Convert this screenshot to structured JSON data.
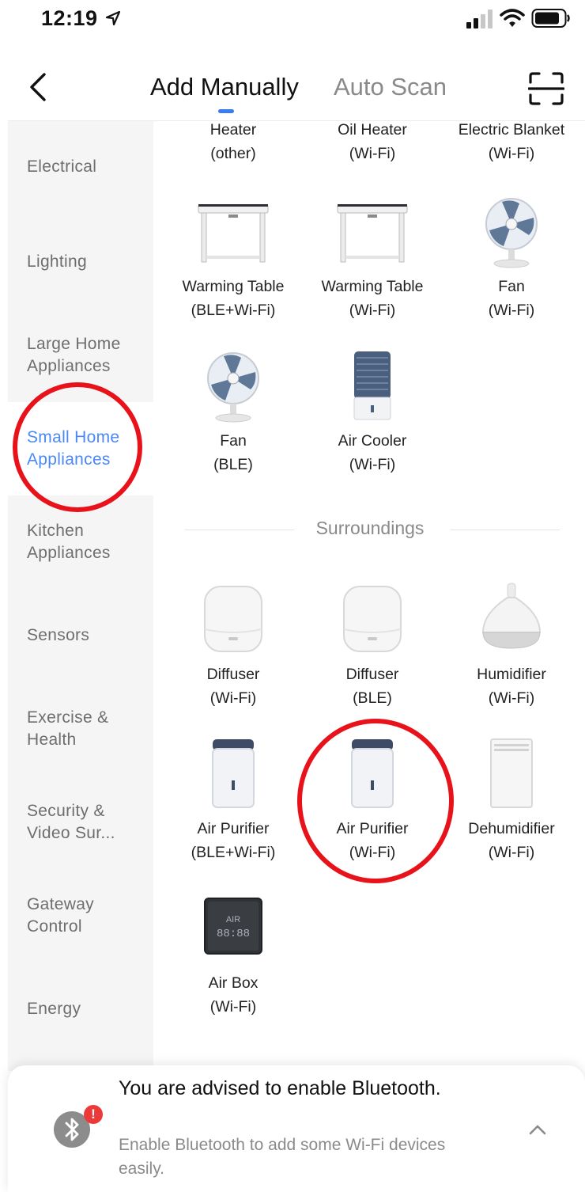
{
  "status_bar": {
    "time": "12:19"
  },
  "header": {
    "tab_active": "Add Manually",
    "tab_inactive": "Auto Scan"
  },
  "sidebar": {
    "items": [
      {
        "label": "Electrical"
      },
      {
        "label": "Lighting"
      },
      {
        "label": "Large Home Appliances"
      },
      {
        "label": "Small Home Appliances"
      },
      {
        "label": "Kitchen Appliances"
      },
      {
        "label": "Sensors"
      },
      {
        "label": "Exercise & Health"
      },
      {
        "label": "Security & Video Sur..."
      },
      {
        "label": "Gateway Control"
      },
      {
        "label": "Energy"
      }
    ],
    "active_item": "Small Home Appliances"
  },
  "devices": [
    {
      "name": "Heater",
      "protocol": "(other)"
    },
    {
      "name": "Oil Heater",
      "protocol": "(Wi-Fi)"
    },
    {
      "name": "Electric Blanket",
      "protocol": "(Wi-Fi)"
    },
    {
      "name": "Warming Table",
      "protocol": "(BLE+Wi-Fi)"
    },
    {
      "name": "Warming Table",
      "protocol": "(Wi-Fi)"
    },
    {
      "name": "Fan",
      "protocol": "(Wi-Fi)"
    },
    {
      "name": "Fan",
      "protocol": "(BLE)"
    },
    {
      "name": "Air Cooler",
      "protocol": "(Wi-Fi)"
    }
  ],
  "section": {
    "title": "Surroundings"
  },
  "surroundings": [
    {
      "name": "Diffuser",
      "protocol": "(Wi-Fi)"
    },
    {
      "name": "Diffuser",
      "protocol": "(BLE)"
    },
    {
      "name": "Humidifier",
      "protocol": "(Wi-Fi)"
    },
    {
      "name": "Air Purifier",
      "protocol": "(BLE+Wi-Fi)"
    },
    {
      "name": "Air Purifier",
      "protocol": "(Wi-Fi)"
    },
    {
      "name": "Dehumidifier",
      "protocol": "(Wi-Fi)"
    },
    {
      "name": "Air Box",
      "protocol": "(Wi-Fi)",
      "screen_text": "AIR",
      "screen_digits": "88:88"
    }
  ],
  "banner": {
    "title": "You are advised to enable Bluetooth.",
    "subtitle": "Enable Bluetooth to add some Wi-Fi devices easily.",
    "badge": "!"
  },
  "colors": {
    "accent": "#4a88f7",
    "annotation": "#e8121b",
    "badge": "#ec3a3a"
  }
}
